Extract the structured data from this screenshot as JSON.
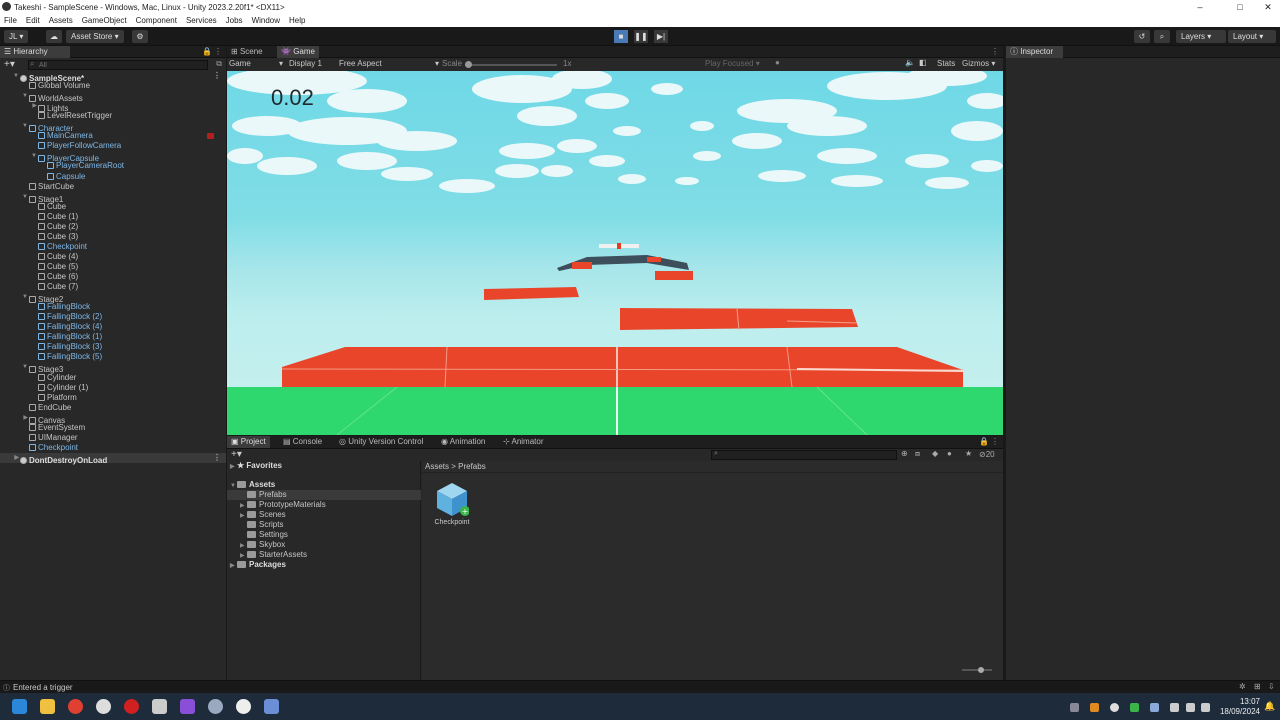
{
  "window": {
    "title": "Takeshi - SampleScene - Windows, Mac, Linux - Unity 2023.2.20f1* <DX11>",
    "minimize": "–",
    "maximize": "□",
    "close": "✕"
  },
  "menu": [
    "File",
    "Edit",
    "Assets",
    "GameObject",
    "Component",
    "Services",
    "Jobs",
    "Window",
    "Help"
  ],
  "toolbar": {
    "account": "JL ▾",
    "asset_store": "Asset Store ▾",
    "layers": "Layers",
    "layout": "Layout"
  },
  "hierarchy": {
    "title": "Hierarchy",
    "search_placeholder": "All",
    "items": [
      {
        "label": "SampleScene*",
        "depth": 0,
        "type": "scene",
        "arrow": "open"
      },
      {
        "label": "Global Volume",
        "depth": 1
      },
      {
        "label": "WorldAssets",
        "depth": 1,
        "arrow": "open"
      },
      {
        "label": "Lights",
        "depth": 2,
        "arrow": "closed"
      },
      {
        "label": "LevelResetTrigger",
        "depth": 2
      },
      {
        "label": "Character",
        "depth": 1,
        "arrow": "open",
        "blue": true
      },
      {
        "label": "MainCamera",
        "depth": 2,
        "blue": true
      },
      {
        "label": "PlayerFollowCamera",
        "depth": 2,
        "blue": true
      },
      {
        "label": "PlayerCapsule",
        "depth": 2,
        "arrow": "open",
        "blue": true
      },
      {
        "label": "PlayerCameraRoot",
        "depth": 3,
        "blue": true
      },
      {
        "label": "Capsule",
        "depth": 3,
        "blue": true
      },
      {
        "label": "StartCube",
        "depth": 1
      },
      {
        "label": "Stage1",
        "depth": 1,
        "arrow": "open"
      },
      {
        "label": "Cube",
        "depth": 2
      },
      {
        "label": "Cube (1)",
        "depth": 2
      },
      {
        "label": "Cube (2)",
        "depth": 2
      },
      {
        "label": "Cube (3)",
        "depth": 2
      },
      {
        "label": "Checkpoint",
        "depth": 2,
        "blue": true
      },
      {
        "label": "Cube (4)",
        "depth": 2
      },
      {
        "label": "Cube (5)",
        "depth": 2
      },
      {
        "label": "Cube (6)",
        "depth": 2
      },
      {
        "label": "Cube (7)",
        "depth": 2
      },
      {
        "label": "Stage2",
        "depth": 1,
        "arrow": "open"
      },
      {
        "label": "FallingBlock",
        "depth": 2,
        "blue": true
      },
      {
        "label": "FallingBlock (2)",
        "depth": 2,
        "blue": true
      },
      {
        "label": "FallingBlock (4)",
        "depth": 2,
        "blue": true
      },
      {
        "label": "FallingBlock (1)",
        "depth": 2,
        "blue": true
      },
      {
        "label": "FallingBlock (3)",
        "depth": 2,
        "blue": true
      },
      {
        "label": "FallingBlock (5)",
        "depth": 2,
        "blue": true
      },
      {
        "label": "Stage3",
        "depth": 1,
        "arrow": "open"
      },
      {
        "label": "Cylinder",
        "depth": 2
      },
      {
        "label": "Cylinder (1)",
        "depth": 2
      },
      {
        "label": "Platform",
        "depth": 2
      },
      {
        "label": "EndCube",
        "depth": 1
      },
      {
        "label": "Canvas",
        "depth": 1,
        "arrow": "closed"
      },
      {
        "label": "EventSystem",
        "depth": 1
      },
      {
        "label": "UIManager",
        "depth": 1
      },
      {
        "label": "Checkpoint",
        "depth": 1,
        "blue": true
      },
      {
        "label": "DontDestroyOnLoad",
        "depth": 0,
        "type": "scene",
        "arrow": "closed",
        "selected": true
      }
    ]
  },
  "view_tabs": {
    "scene": "Scene",
    "game": "Game"
  },
  "game_toolbar": {
    "mode": "Game",
    "display": "Display 1",
    "aspect": "Free Aspect",
    "scale_label": "Scale",
    "scale_value": "1x",
    "play_focused": "Play Focused",
    "stats": "Stats",
    "gizmos": "Gizmos"
  },
  "game": {
    "timer": "0.02"
  },
  "inspector": {
    "title": "Inspector"
  },
  "bottom_tabs": [
    "Project",
    "Console",
    "Unity Version Control",
    "Animation",
    "Animator"
  ],
  "project": {
    "favorites": "Favorites",
    "assets": "Assets",
    "folders": [
      "Prefabs",
      "PrototypeMaterials",
      "Scenes",
      "Scripts",
      "Settings",
      "Skybox",
      "StarterAssets"
    ],
    "packages": "Packages",
    "breadcrumb": "Assets > Prefabs",
    "count": "20",
    "asset_name": "Checkpoint"
  },
  "status": {
    "message": "Entered a trigger"
  },
  "taskbar": {
    "time": "13:07",
    "date": "18/09/2024"
  }
}
